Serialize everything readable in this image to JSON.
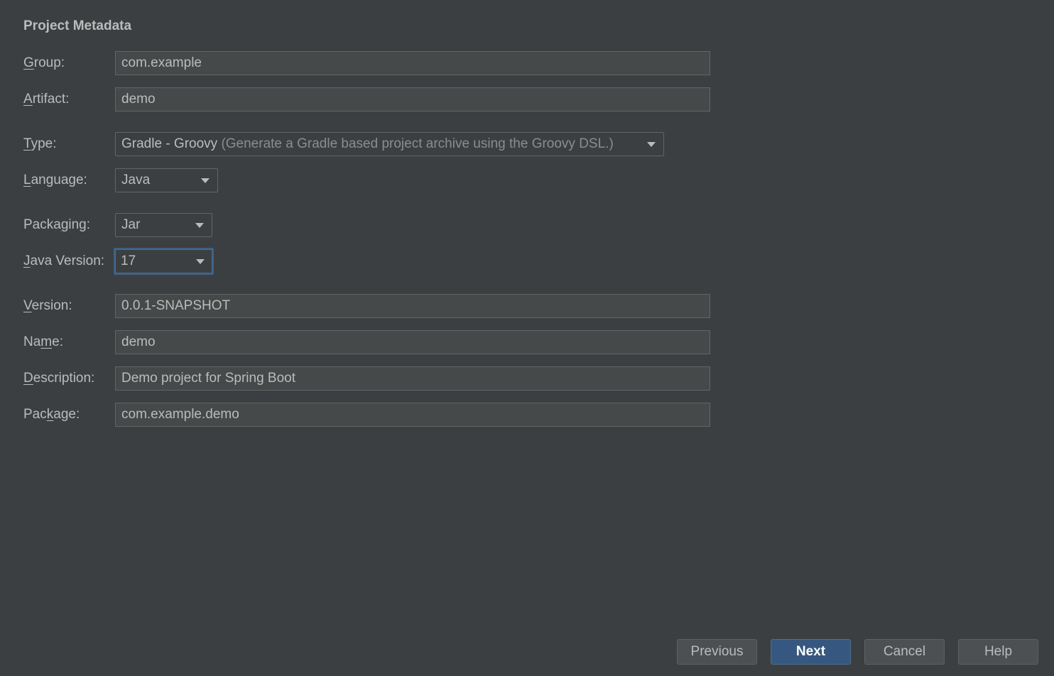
{
  "section_title": "Project Metadata",
  "fields": {
    "group": {
      "label_pre": "",
      "label_mnemonic": "G",
      "label_post": "roup:",
      "value": "com.example"
    },
    "artifact": {
      "label_pre": "",
      "label_mnemonic": "A",
      "label_post": "rtifact:",
      "value": "demo"
    },
    "type": {
      "label_pre": "",
      "label_mnemonic": "T",
      "label_post": "ype:",
      "value": "Gradle - Groovy",
      "hint": "(Generate a Gradle based project archive using the Groovy DSL.)"
    },
    "language": {
      "label_pre": "",
      "label_mnemonic": "L",
      "label_post": "anguage:",
      "value": "Java"
    },
    "packaging": {
      "label_pre": "Packa",
      "label_mnemonic": "g",
      "label_post": "ing:",
      "value": "Jar"
    },
    "java_version": {
      "label_pre": "",
      "label_mnemonic": "J",
      "label_post": "ava Version:",
      "value": "17"
    },
    "version": {
      "label_pre": "",
      "label_mnemonic": "V",
      "label_post": "ersion:",
      "value": "0.0.1-SNAPSHOT"
    },
    "name": {
      "label_pre": "Na",
      "label_mnemonic": "m",
      "label_post": "e:",
      "value": "demo"
    },
    "description": {
      "label_pre": "",
      "label_mnemonic": "D",
      "label_post": "escription:",
      "value": "Demo project for Spring Boot"
    },
    "package": {
      "label_pre": "Pac",
      "label_mnemonic": "k",
      "label_post": "age:",
      "value": "com.example.demo"
    }
  },
  "buttons": {
    "previous": "Previous",
    "next": "Next",
    "cancel": "Cancel",
    "help": "Help"
  },
  "colors": {
    "background": "#3c3f41",
    "field_background": "#45494a",
    "primary_button": "#365880",
    "focus_border": "#3d6185"
  }
}
